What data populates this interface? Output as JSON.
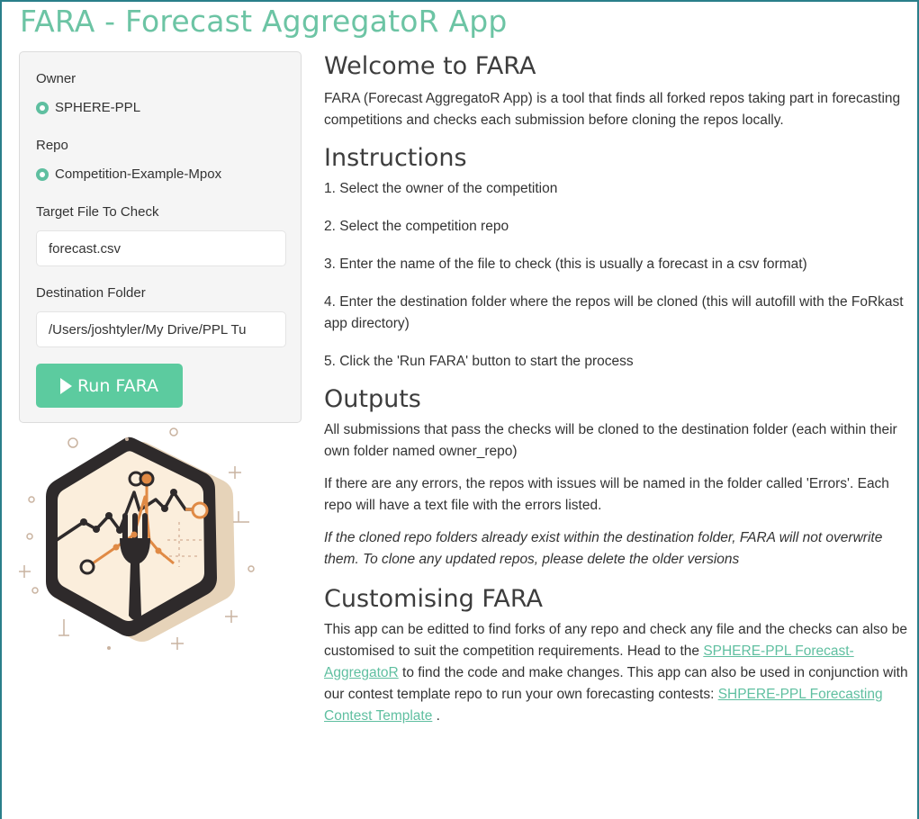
{
  "app": {
    "title": "FARA - Forecast AggregatoR App"
  },
  "sidebar": {
    "owner_label": "Owner",
    "owner_selected": "SPHERE-PPL",
    "repo_label": "Repo",
    "repo_selected": "Competition-Example-Mpox",
    "target_label": "Target File To Check",
    "target_value": "forecast.csv",
    "dest_label": "Destination Folder",
    "dest_value": "/Users/joshtyler/My Drive/PPL Tu",
    "run_label": "Run FARA",
    "accent_color": "#5ccb9f",
    "run_icon": "play-icon"
  },
  "logo": {
    "icon": "fork-chart-hexagon-logo"
  },
  "main": {
    "welcome_heading": "Welcome to FARA",
    "welcome_text": "FARA (Forecast AggregatoR App) is a tool that finds all forked repos taking part in forecasting competitions and checks each submission before cloning the repos locally.",
    "instructions_heading": "Instructions",
    "instructions": [
      "1. Select the owner of the competition",
      "2. Select the competition repo",
      "3. Enter the name of the file to check (this is usually a forecast in a csv format)",
      "4. Enter the destination folder where the repos will be cloned (this will autofill with the FoRkast app directory)",
      "5. Click the 'Run FARA' button to start the process"
    ],
    "outputs_heading": "Outputs",
    "outputs_p1": "All submissions that pass the checks will be cloned to the destination folder (each within their own folder named owner_repo)",
    "outputs_p2": "If there are any errors, the repos with issues will be named in the folder called 'Errors'. Each repo will have a text file with the errors listed.",
    "outputs_note": "If the cloned repo folders already exist within the destination folder, FARA will not overwrite them. To clone any updated repos, please delete the older versions",
    "custom_heading": "Customising FARA",
    "custom_text_1": "This app can be editted to find forks of any repo and check any file and the checks can also be customised to suit the competition requirements. Head to the ",
    "custom_link_1": "SPHERE-PPL Forecast-AggregatoR",
    "custom_text_2": " to find the code and make changes. This app can also be used in conjunction with our contest template repo to run your own forecasting contests: ",
    "custom_link_2": "SHPERE-PPL Forecasting Contest Template",
    "custom_text_3": " ."
  }
}
